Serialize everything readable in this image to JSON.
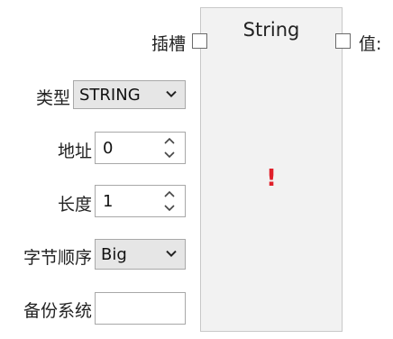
{
  "block": {
    "title": "String",
    "error_mark": "!",
    "input_port_label": "插槽",
    "output_port_label": "值:"
  },
  "fields": {
    "type": {
      "label": "类型",
      "value": "STRING"
    },
    "address": {
      "label": "地址",
      "value": "0"
    },
    "length": {
      "label": "长度",
      "value": "1"
    },
    "byte_order": {
      "label": "字节顺序",
      "value": "Big"
    },
    "backup_system": {
      "label": "备份系统",
      "value": ""
    }
  },
  "colors": {
    "panel_bg": "#f2f2f2",
    "error": "#e0202a",
    "select_bg": "#e6e6e6",
    "border": "#a8a8a8"
  },
  "icons": {
    "dropdown": "chevron-down-icon",
    "spin_up": "chevron-up-icon",
    "spin_down": "chevron-down-icon"
  }
}
